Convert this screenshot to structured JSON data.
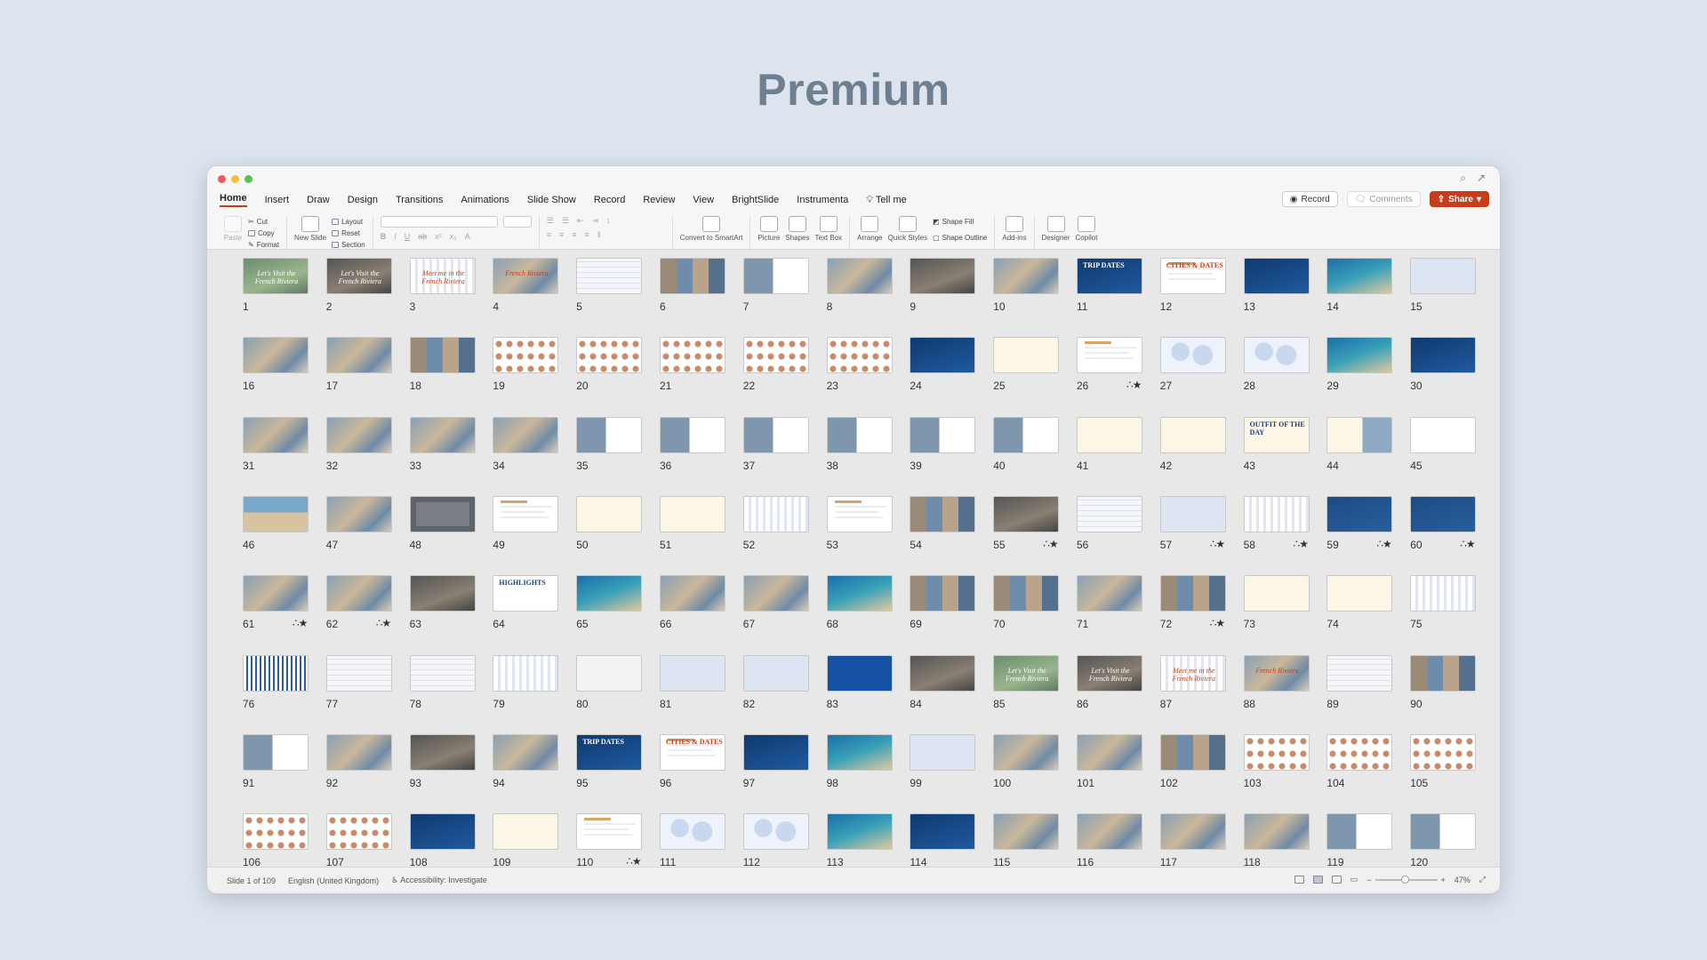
{
  "heading": "Premium",
  "window": {
    "lights": [
      "#ee5d55",
      "#f5bd3b",
      "#52c454"
    ]
  },
  "tabs": [
    "Home",
    "Insert",
    "Draw",
    "Design",
    "Transitions",
    "Animations",
    "Slide Show",
    "Record",
    "Review",
    "View",
    "BrightSlide",
    "Instrumenta",
    "Tell me"
  ],
  "active_tab": "Home",
  "top_right": {
    "record": "Record",
    "comments": "Comments",
    "share": "Share"
  },
  "ribbon": {
    "paste": "Paste",
    "cut": "Cut",
    "copy": "Copy",
    "format": "Format",
    "new_slide": "New Slide",
    "layout": "Layout",
    "reset": "Reset",
    "section": "Section",
    "convert": "Convert to SmartArt",
    "picture": "Picture",
    "shapes": "Shapes",
    "textbox": "Text Box",
    "arrange": "Arrange",
    "quick_styles": "Quick Styles",
    "shape_fill": "Shape Fill",
    "shape_outline": "Shape Outline",
    "addins": "Add-ins",
    "designer": "Designer",
    "copilot": "Copilot"
  },
  "slides": [
    {
      "n": "1",
      "s": "green",
      "t": "Let's Visit the French Riviera"
    },
    {
      "n": "2",
      "s": "dark",
      "t": "Let's Visit the French Riviera"
    },
    {
      "n": "3",
      "s": "stripe",
      "t": "Meet me in the French Riviera",
      "c": "red"
    },
    {
      "n": "4",
      "s": "photo",
      "t": "French Riviera",
      "c": "red"
    },
    {
      "n": "5",
      "s": "lines"
    },
    {
      "n": "6",
      "s": "collage"
    },
    {
      "n": "7",
      "s": "photodoc"
    },
    {
      "n": "8",
      "s": "photo"
    },
    {
      "n": "9",
      "s": "dark"
    },
    {
      "n": "10",
      "s": "photo"
    },
    {
      "n": "11",
      "s": "navy",
      "t": "TRIP DATES",
      "up": true
    },
    {
      "n": "12",
      "s": "doc",
      "t": "CITIES & DATES",
      "c": "red",
      "up": true
    },
    {
      "n": "13",
      "s": "navy"
    },
    {
      "n": "14",
      "s": "sea"
    },
    {
      "n": "15",
      "s": "pale"
    },
    {
      "n": "16",
      "s": "photo"
    },
    {
      "n": "17",
      "s": "photo"
    },
    {
      "n": "18",
      "s": "collage"
    },
    {
      "n": "19",
      "s": "dots"
    },
    {
      "n": "20",
      "s": "dots"
    },
    {
      "n": "21",
      "s": "dots"
    },
    {
      "n": "22",
      "s": "dots"
    },
    {
      "n": "23",
      "s": "dots"
    },
    {
      "n": "24",
      "s": "navy"
    },
    {
      "n": "25",
      "s": "cream"
    },
    {
      "n": "26",
      "s": "doc",
      "star": true
    },
    {
      "n": "27",
      "s": "map"
    },
    {
      "n": "28",
      "s": "map"
    },
    {
      "n": "29",
      "s": "sea"
    },
    {
      "n": "30",
      "s": "navy"
    },
    {
      "n": "31",
      "s": "photo"
    },
    {
      "n": "32",
      "s": "photo"
    },
    {
      "n": "33",
      "s": "photo"
    },
    {
      "n": "34",
      "s": "photo"
    },
    {
      "n": "35",
      "s": "photodoc"
    },
    {
      "n": "36",
      "s": "photodoc"
    },
    {
      "n": "37",
      "s": "photodoc"
    },
    {
      "n": "38",
      "s": "photodoc"
    },
    {
      "n": "39",
      "s": "photodoc"
    },
    {
      "n": "40",
      "s": "photodoc"
    },
    {
      "n": "41",
      "s": "cream"
    },
    {
      "n": "42",
      "s": "cream"
    },
    {
      "n": "43",
      "s": "cream",
      "t": "OUTFIT OF THE DAY",
      "c": "navy",
      "up": true
    },
    {
      "n": "44",
      "s": "cream2"
    },
    {
      "n": "45",
      "s": "white"
    },
    {
      "n": "46",
      "s": "beach"
    },
    {
      "n": "47",
      "s": "photo"
    },
    {
      "n": "48",
      "s": "frame"
    },
    {
      "n": "49",
      "s": "doc"
    },
    {
      "n": "50",
      "s": "cream"
    },
    {
      "n": "51",
      "s": "cream"
    },
    {
      "n": "52",
      "s": "stripe"
    },
    {
      "n": "53",
      "s": "doc"
    },
    {
      "n": "54",
      "s": "collage"
    },
    {
      "n": "55",
      "s": "dark",
      "star": true
    },
    {
      "n": "56",
      "s": "lines"
    },
    {
      "n": "57",
      "s": "pale",
      "star": true
    },
    {
      "n": "58",
      "s": "stripe",
      "star": true
    },
    {
      "n": "59",
      "s": "envelope",
      "star": true
    },
    {
      "n": "60",
      "s": "envelope",
      "star": true
    },
    {
      "n": "61",
      "s": "photo",
      "star": true
    },
    {
      "n": "62",
      "s": "photo",
      "star": true
    },
    {
      "n": "63",
      "s": "dark"
    },
    {
      "n": "64",
      "s": "white",
      "t": "HIGHLIGHTS",
      "c": "navy",
      "up": true
    },
    {
      "n": "65",
      "s": "sea"
    },
    {
      "n": "66",
      "s": "photo"
    },
    {
      "n": "67",
      "s": "photo"
    },
    {
      "n": "68",
      "s": "sea"
    },
    {
      "n": "69",
      "s": "collage"
    },
    {
      "n": "70",
      "s": "collage"
    },
    {
      "n": "71",
      "s": "photo"
    },
    {
      "n": "72",
      "s": "collage",
      "star": true
    },
    {
      "n": "73",
      "s": "cream"
    },
    {
      "n": "74",
      "s": "cream"
    },
    {
      "n": "75",
      "s": "stripe"
    },
    {
      "n": "76",
      "s": "stripebold"
    },
    {
      "n": "77",
      "s": "lines"
    },
    {
      "n": "78",
      "s": "lines"
    },
    {
      "n": "79",
      "s": "stripe"
    },
    {
      "n": "80",
      "s": "light"
    },
    {
      "n": "81",
      "s": "pale"
    },
    {
      "n": "82",
      "s": "pale"
    },
    {
      "n": "83",
      "s": "blue"
    },
    {
      "n": "84",
      "s": "dark"
    },
    {
      "n": "85",
      "s": "green",
      "t": "Let's Visit the French Riviera"
    },
    {
      "n": "86",
      "s": "dark",
      "t": "Let's Visit the French Riviera"
    },
    {
      "n": "87",
      "s": "stripe",
      "t": "Meet me in the French Riviera",
      "c": "red"
    },
    {
      "n": "88",
      "s": "photo",
      "t": "French Riviera",
      "c": "red"
    },
    {
      "n": "89",
      "s": "lines"
    },
    {
      "n": "90",
      "s": "collage"
    },
    {
      "n": "91",
      "s": "photodoc"
    },
    {
      "n": "92",
      "s": "photo"
    },
    {
      "n": "93",
      "s": "dark"
    },
    {
      "n": "94",
      "s": "photo"
    },
    {
      "n": "95",
      "s": "navy",
      "t": "TRIP DATES",
      "up": true
    },
    {
      "n": "96",
      "s": "doc",
      "t": "CITIES & DATES",
      "c": "red",
      "up": true
    },
    {
      "n": "97",
      "s": "navy"
    },
    {
      "n": "98",
      "s": "sea"
    },
    {
      "n": "99",
      "s": "pale"
    },
    {
      "n": "100",
      "s": "photo"
    },
    {
      "n": "101",
      "s": "photo"
    },
    {
      "n": "102",
      "s": "collage"
    },
    {
      "n": "103",
      "s": "dots"
    },
    {
      "n": "104",
      "s": "dots"
    },
    {
      "n": "105",
      "s": "dots"
    },
    {
      "n": "106",
      "s": "dots"
    },
    {
      "n": "107",
      "s": "dots"
    },
    {
      "n": "108",
      "s": "navy"
    },
    {
      "n": "109",
      "s": "cream"
    },
    {
      "n": "110",
      "s": "doc",
      "star": true
    },
    {
      "n": "111",
      "s": "map"
    },
    {
      "n": "112",
      "s": "map"
    },
    {
      "n": "113",
      "s": "sea"
    },
    {
      "n": "114",
      "s": "navy"
    },
    {
      "n": "115",
      "s": "photo"
    },
    {
      "n": "116",
      "s": "photo"
    },
    {
      "n": "117",
      "s": "photo"
    },
    {
      "n": "118",
      "s": "photo"
    },
    {
      "n": "119",
      "s": "photodoc"
    },
    {
      "n": "120",
      "s": "photodoc"
    }
  ],
  "status": {
    "slide": "Slide 1 of 109",
    "language": "English (United Kingdom)",
    "accessibility": "Accessibility: Investigate",
    "zoom": "47%",
    "zoom_level": 0.47
  }
}
